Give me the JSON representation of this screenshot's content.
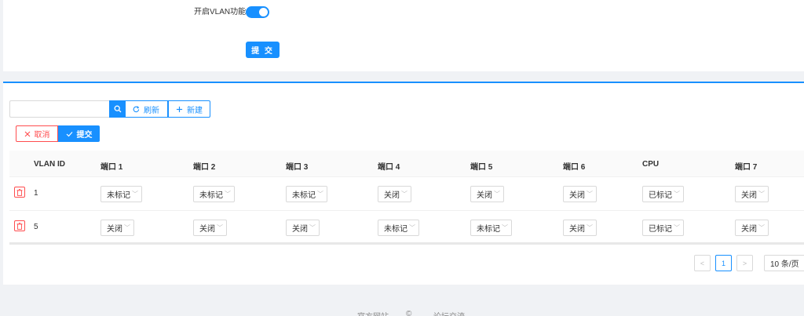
{
  "vlan": {
    "label": "开启VLAN功能",
    "enabled": true,
    "submit_label": "提 交"
  },
  "toolbar": {
    "search_placeholder": "",
    "refresh_label": "刷新",
    "new_label": "新建"
  },
  "actions": {
    "cancel_label": "取消",
    "submit_label": "提交"
  },
  "table": {
    "columns": [
      "VLAN ID",
      "端口 1",
      "端口 2",
      "端口 3",
      "端口 4",
      "端口 5",
      "端口 6",
      "CPU",
      "端口 7"
    ],
    "rows": [
      {
        "id": "1",
        "cells": [
          "未标记",
          "未标记",
          "未标记",
          "关闭",
          "关闭",
          "关闭",
          "已标记",
          "关闭"
        ]
      },
      {
        "id": "5",
        "cells": [
          "关闭",
          "关闭",
          "关闭",
          "未标记",
          "未标记",
          "关闭",
          "已标记",
          "关闭"
        ]
      }
    ]
  },
  "pagination": {
    "prev": "<",
    "current": "1",
    "next": ">",
    "page_size": "10 条/页"
  },
  "footer": {
    "link1": "官方网站",
    "link2": "论坛交流"
  }
}
